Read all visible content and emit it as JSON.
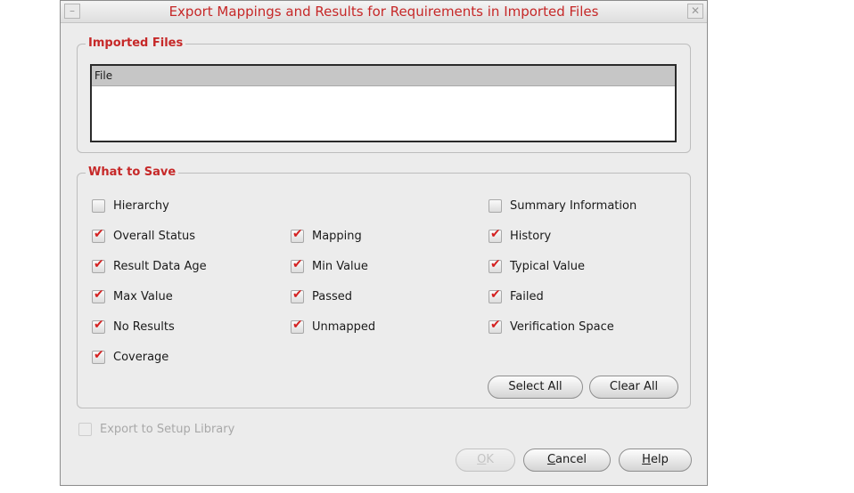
{
  "dialog": {
    "title": "Export Mappings and Results for Requirements in Imported Files"
  },
  "imported_files": {
    "title": "Imported Files",
    "columns": [
      "File"
    ],
    "rows": []
  },
  "what_to_save": {
    "title": "What to Save",
    "options": [
      {
        "label": "Hierarchy",
        "checked": false
      },
      {
        "label": "Summary Information",
        "checked": false
      },
      {
        "label": "Overall Status",
        "checked": true
      },
      {
        "label": "Mapping",
        "checked": true
      },
      {
        "label": "History",
        "checked": true
      },
      {
        "label": "Result Data Age",
        "checked": true
      },
      {
        "label": "Min Value",
        "checked": true
      },
      {
        "label": "Typical Value",
        "checked": true
      },
      {
        "label": "Max Value",
        "checked": true
      },
      {
        "label": "Passed",
        "checked": true
      },
      {
        "label": "Failed",
        "checked": true
      },
      {
        "label": "No Results",
        "checked": true
      },
      {
        "label": "Unmapped",
        "checked": true
      },
      {
        "label": "Verification Space",
        "checked": true
      },
      {
        "label": "Coverage",
        "checked": true
      }
    ],
    "select_all_label": "Select All",
    "clear_all_label": "Clear All"
  },
  "export_to_setup_library": {
    "label": "Export to Setup Library",
    "checked": false,
    "enabled": false
  },
  "footer": {
    "ok": {
      "first": "O",
      "rest": "K",
      "enabled": false
    },
    "cancel": {
      "first": "C",
      "rest": "ancel"
    },
    "help": {
      "first": "H",
      "rest": "elp"
    }
  },
  "colors": {
    "title_red": "#c62828",
    "check_red": "#d42020"
  }
}
